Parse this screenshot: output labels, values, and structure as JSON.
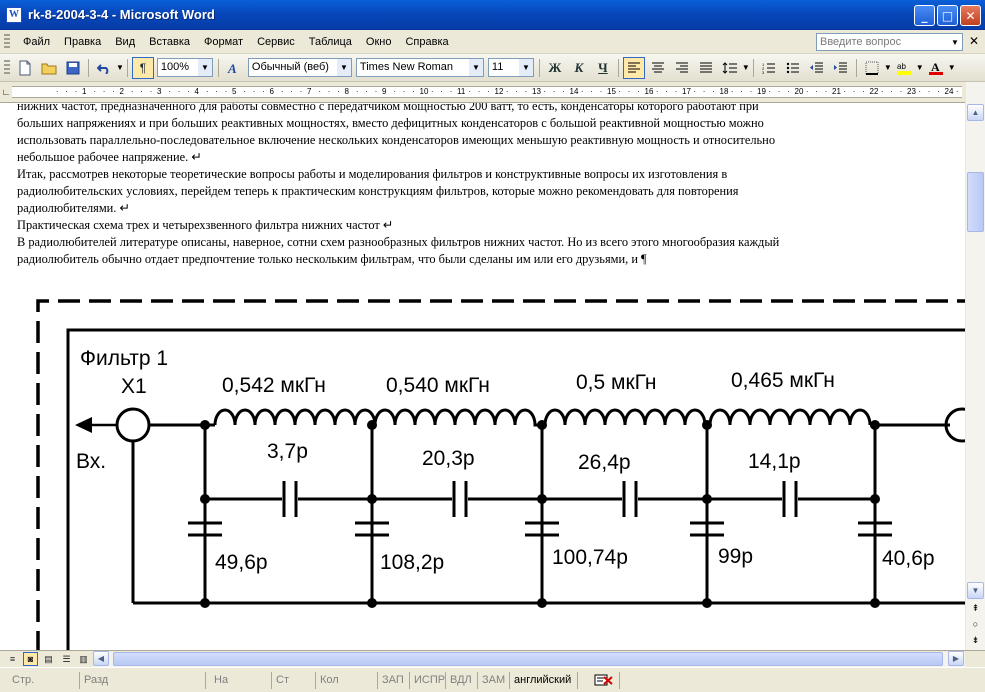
{
  "window": {
    "title": "rk-8-2004-3-4 - Microsoft Word",
    "app_icon": "W",
    "controls": {
      "minimize": "_",
      "maximize": "□",
      "close": "✕"
    }
  },
  "menu": {
    "items": [
      "Файл",
      "Правка",
      "Вид",
      "Вставка",
      "Формат",
      "Сервис",
      "Таблица",
      "Окно",
      "Справка"
    ],
    "ask_placeholder": "Введите вопрос",
    "close": "✕"
  },
  "toolbar": {
    "zoom": "100%",
    "style": "Обычный (веб)",
    "font": "Times New Roman",
    "size": "11",
    "bold": "Ж",
    "italic": "К",
    "underline": "Ч",
    "format_pilcrow": "¶"
  },
  "ruler": {
    "marks": [
      "1",
      "2",
      "3",
      "4",
      "5",
      "6",
      "7",
      "8",
      "9",
      "10",
      "11",
      "12",
      "13",
      "14",
      "15",
      "16",
      "17",
      "18",
      "19",
      "20",
      "21",
      "22",
      "23",
      "24",
      "25"
    ]
  },
  "document": {
    "paragraphs": [
      "нижних частот, предназначенного для работы совместно с передатчиком мощностью 200 ватт, то есть, конденсаторы которого работают при",
      "больших напряжениях и при больших реактивных мощностях, вместо дефицитных конденсаторов с большой реактивной мощностью можно",
      "использовать параллельно-последовательное включение нескольких конденсаторов имеющих меньшую реактивную мощность и относительно",
      "небольшое рабочее напряжение. ↵",
      "Итак, рассмотрев некоторые теоретические вопросы работы и моделирования фильтров и конструктивные вопросы их изготовления в",
      "радиолюбительских условиях, перейдем теперь к практическим конструкциям фильтров, которые можно рекомендовать для повторения",
      "радиолюбителями. ↵",
      "Практическая схема трех и четырехзвенного фильтра нижних частот ↵",
      "В радиолюбителей литературе описаны, наверное, сотни схем разнообразных фильтров нижних частот. Но из всего этого многообразия каждый",
      "радиолюбитель обычно отдает предпочтение только нескольким фильтрам, что были сделаны им или его друзьями, и ¶"
    ]
  },
  "figure": {
    "title": "Фильтр 1",
    "connector": "X1",
    "input_label": "Вх.",
    "inductors": [
      "0,542 мкГн",
      "0,540 мкГн",
      "0,5 мкГн",
      "0,465 мкГн"
    ],
    "series_caps": [
      "3,7р",
      "20,3р",
      "26,4р",
      "14,1р"
    ],
    "shunt_caps": [
      "49,6р",
      "108,2р",
      "100,74р",
      "99р",
      "40,6р"
    ]
  },
  "statusbar": {
    "page": "Стр.",
    "section": "Разд",
    "at": "На",
    "line": "Ст",
    "col": "Кол",
    "rec": "ЗАП",
    "trk": "ИСПР",
    "ext": "ВДЛ",
    "ovr": "ЗАМ",
    "language": "английский"
  }
}
